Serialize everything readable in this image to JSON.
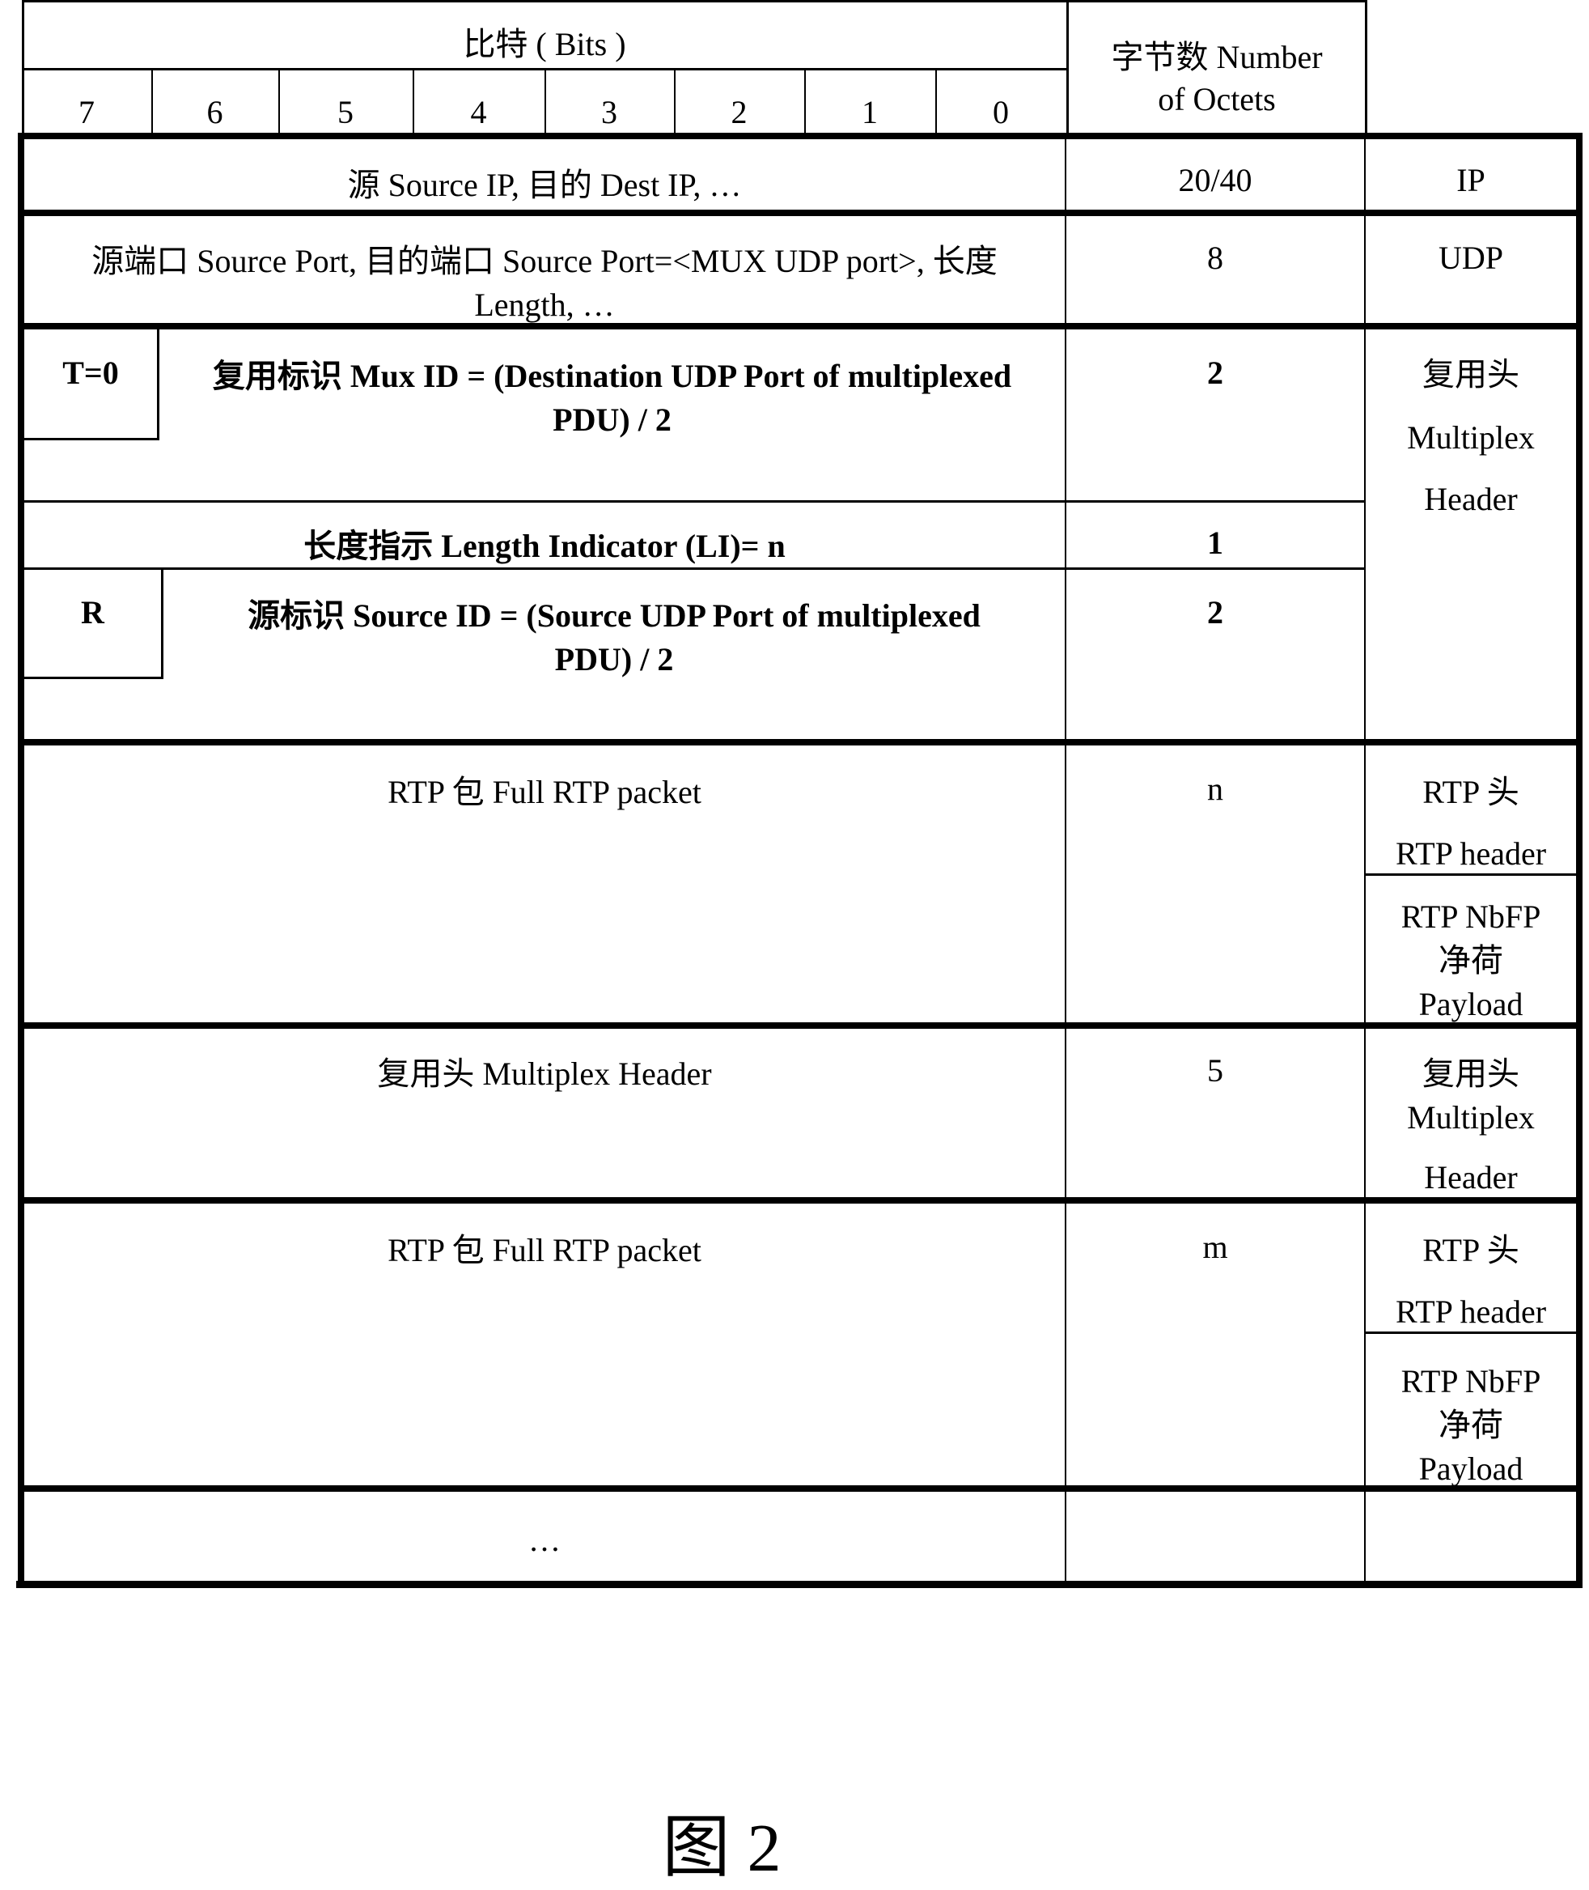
{
  "header": {
    "bits_label": "比特 ( Bits )",
    "bit_numbers": [
      "7",
      "6",
      "5",
      "4",
      "3",
      "2",
      "1",
      "0"
    ],
    "octets_label_line1": "字节数 Number",
    "octets_label_line2": "of Octets"
  },
  "rows": {
    "ip": {
      "field": "源 Source IP, 目的 Dest IP, …",
      "octets": "20/40",
      "layer": "IP"
    },
    "udp": {
      "field_line1": "源端口 Source Port, 目的端口 Source Port=<MUX UDP port>, 长度",
      "field_line2": "Length, …",
      "octets": "8",
      "layer": "UDP"
    },
    "mux_id": {
      "flag": "T=0",
      "field_line1": "复用标识 Mux ID = (Destination UDP Port of multiplexed",
      "field_line2": "PDU) / 2",
      "octets": "2"
    },
    "length_indicator": {
      "field": "长度指示 Length Indicator (LI)= n",
      "octets": "1"
    },
    "source_id": {
      "flag": "R",
      "field_line1": "源标识 Source ID = (Source UDP Port of multiplexed",
      "field_line2": "PDU) / 2",
      "octets": "2"
    },
    "mux_header_layer": {
      "line1": "复用头",
      "line2": "Multiplex",
      "line3": "Header"
    },
    "rtp1": {
      "field": "RTP 包 Full RTP packet",
      "octets": "n",
      "header_line1": "RTP 头",
      "header_line2": "RTP header",
      "payload_line1": "RTP NbFP",
      "payload_line2": "净荷",
      "payload_line3": "Payload"
    },
    "mux_header2": {
      "field": "复用头 Multiplex Header",
      "octets": "5",
      "layer_line1": "复用头",
      "layer_line2": "Multiplex",
      "layer_line3": "Header"
    },
    "rtp2": {
      "field": "RTP 包 Full RTP packet",
      "octets": "m",
      "header_line1": "RTP  头",
      "header_line2": "RTP header",
      "payload_line1": "RTP NbFP",
      "payload_line2": "净荷",
      "payload_line3": "Payload"
    },
    "ellipsis": {
      "field": "…"
    }
  },
  "caption": "图 2"
}
